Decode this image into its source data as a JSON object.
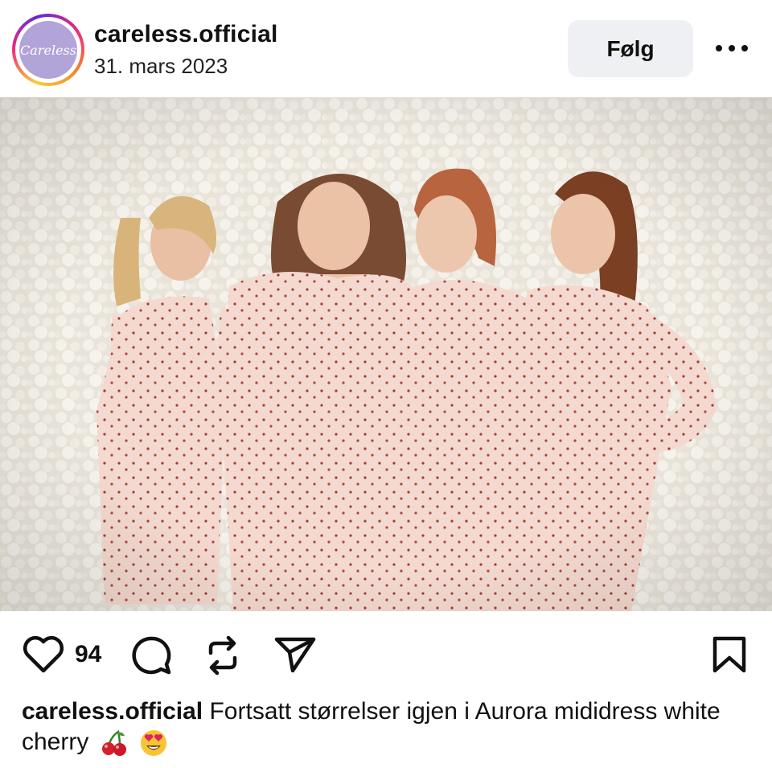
{
  "post": {
    "username": "careless.official",
    "date": "31. mars 2023",
    "avatar_text": "Careless"
  },
  "header": {
    "follow_label": "Følg"
  },
  "actions": {
    "like_count": "94"
  },
  "caption": {
    "username": "careless.official",
    "text": "Fortsatt størrelser igjen i Aurora mididress white cherry"
  },
  "colors": {
    "follow_bg": "#eef0f4",
    "avatar_bg": "#b2a3d9",
    "dress": "#f3d9cf",
    "wall": "#ece7df"
  }
}
